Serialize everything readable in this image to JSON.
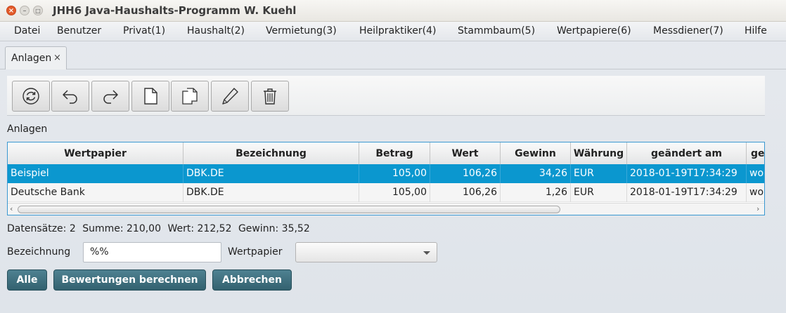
{
  "window": {
    "title": "JHH6 Java-Haushalts-Programm W. Kuehl"
  },
  "menu": [
    "Datei",
    "Benutzer",
    "Privat(1)",
    "Haushalt(2)",
    "Vermietung(3)",
    "Heilpraktiker(4)",
    "Stammbaum(5)",
    "Wertpapiere(6)",
    "Messdiener(7)",
    "Hilfe"
  ],
  "tab": {
    "label": "Anlagen",
    "close": "×"
  },
  "toolbar": [
    "refresh-icon",
    "undo-icon",
    "redo-icon",
    "new-document-icon",
    "copy-icon",
    "edit-pencil-icon",
    "trash-icon"
  ],
  "section_label": "Anlagen",
  "table": {
    "columns": [
      "Wertpapier",
      "Bezeichnung",
      "Betrag",
      "Wert",
      "Gewinn",
      "Währung",
      "geändert am",
      "ge"
    ],
    "rows": [
      [
        "Beispiel",
        "DBK.DE",
        "105,00",
        "106,26",
        "34,26",
        "EUR",
        "2018-01-19T17:34:29",
        "wol"
      ],
      [
        "Deutsche Bank",
        "DBK.DE",
        "105,00",
        "106,26",
        "1,26",
        "EUR",
        "2018-01-19T17:34:29",
        "wol"
      ]
    ],
    "selected_row": 0
  },
  "summary": {
    "datensaetze": "Datensätze: 2",
    "summe": "Summe: 210,00",
    "wert": "Wert: 212,52",
    "gewinn": "Gewinn: 35,52"
  },
  "filter": {
    "bezeichnung_label": "Bezeichnung",
    "bezeichnung_value": "%%",
    "wertpapier_label": "Wertpapier",
    "wertpapier_value": ""
  },
  "buttons": {
    "alle": "Alle",
    "berechnen": "Bewertungen berechnen",
    "abbrechen": "Abbrechen"
  },
  "colors": {
    "selection": "#0b97cf",
    "action_button": "#3f6f7e",
    "window_close": "#e25b2b"
  }
}
